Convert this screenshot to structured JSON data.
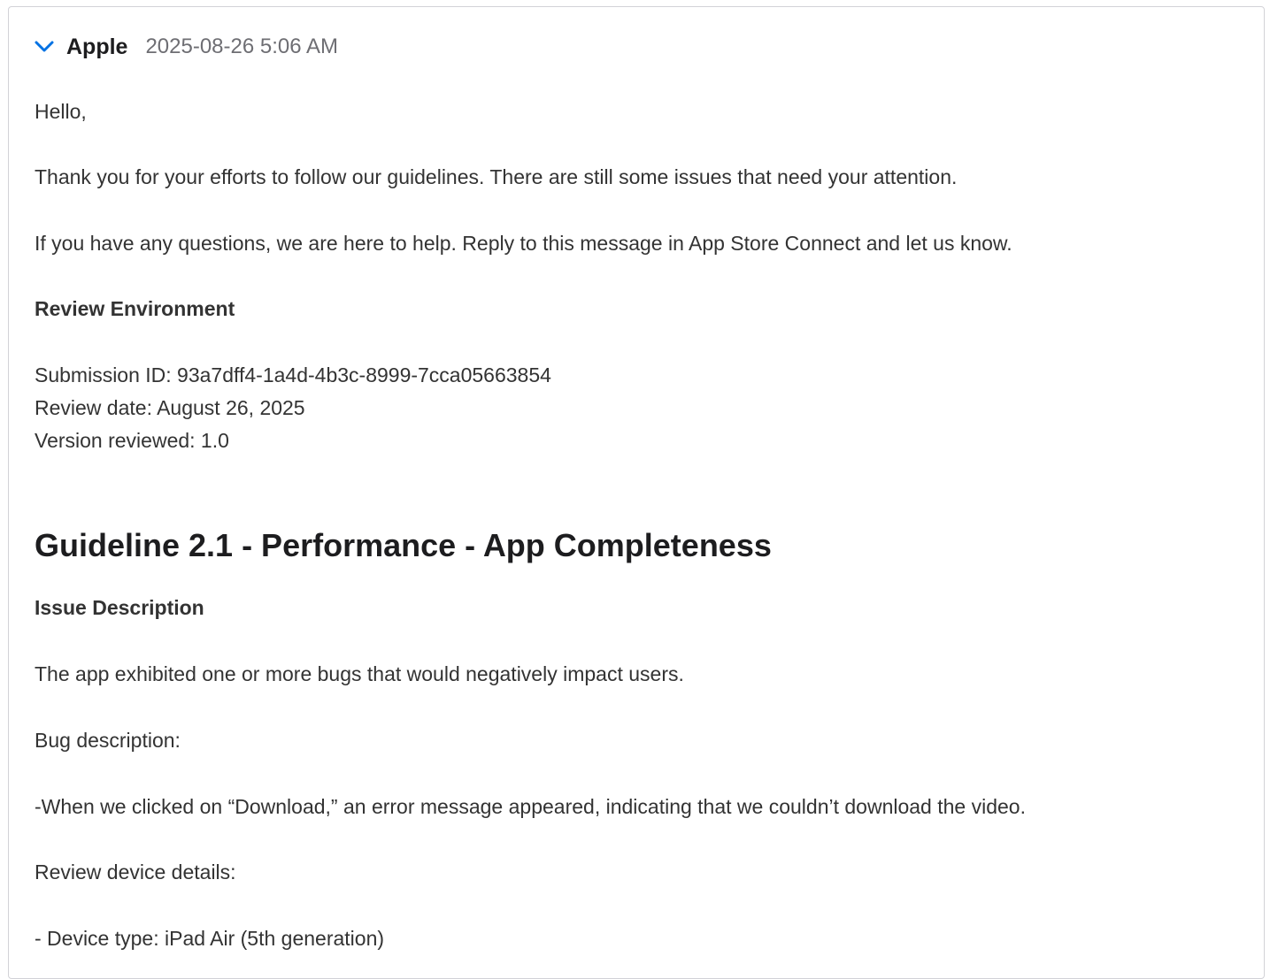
{
  "message": {
    "sender": "Apple",
    "timestamp": "2025-08-26 5:06 AM",
    "greeting": "Hello,",
    "intro": "Thank you for your efforts to follow our guidelines. There are still some issues that need your attention.",
    "help": "If you have any questions, we are here to help. Reply to this message in App Store Connect and let us know.",
    "review_env_heading": "Review Environment",
    "submission_id": "Submission ID: 93a7dff4-1a4d-4b3c-8999-7cca05663854",
    "review_date": "Review date: August 26, 2025",
    "version_reviewed": "Version reviewed: 1.0",
    "guideline_heading": "Guideline 2.1 - Performance - App Completeness",
    "issue_heading": "Issue Description",
    "issue_text": "The app exhibited one or more bugs that would negatively impact users.",
    "bug_desc_label": "Bug description:",
    "bug_desc_text": "-When we clicked on “Download,” an error message appeared, indicating that we couldn’t download the video.",
    "device_details_label": "Review device details:",
    "device_type": "- Device type: iPad Air (5th generation)"
  },
  "icons": {
    "collapse": "chevron-down-icon"
  },
  "colors": {
    "accent": "#0071e3",
    "border": "#d2d2d7",
    "text": "#333333",
    "muted": "#6e6e73"
  }
}
